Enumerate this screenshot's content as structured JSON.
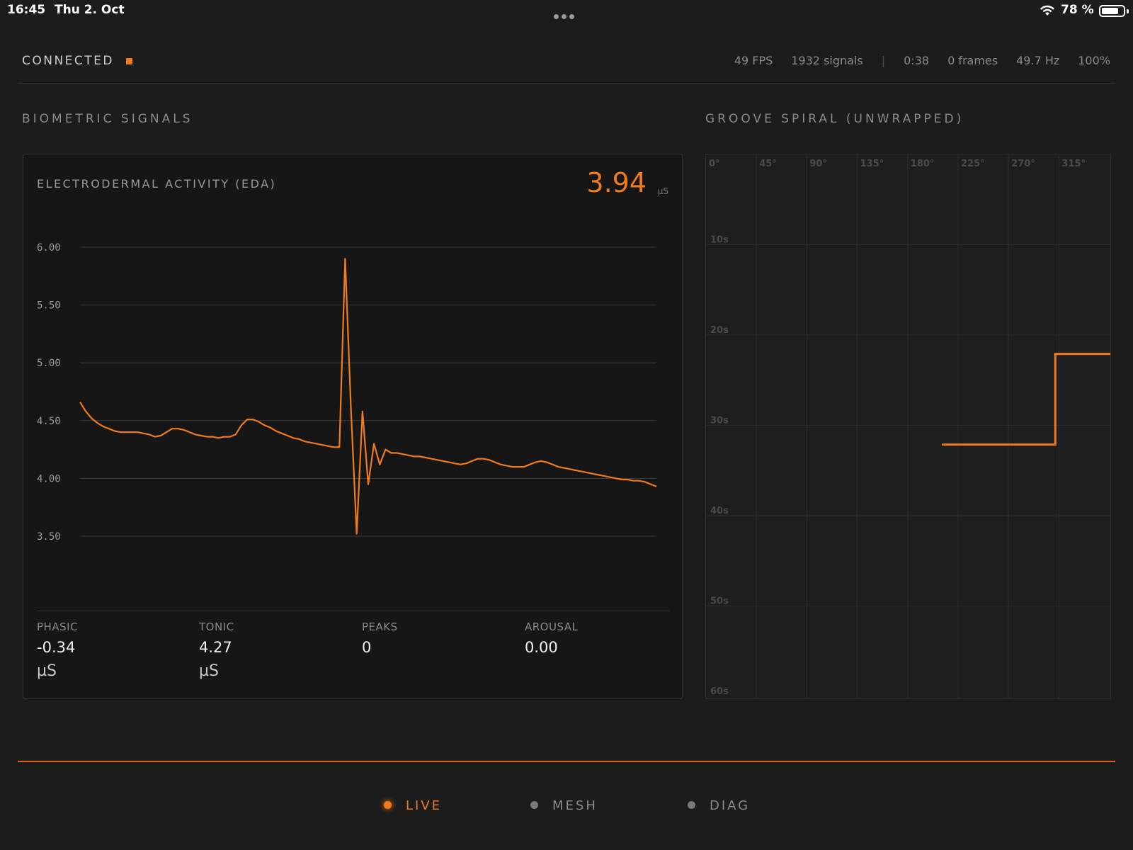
{
  "status_bar": {
    "time": "16:45",
    "date": "Thu 2. Oct",
    "battery_percent": "78 %",
    "battery_level": 0.78
  },
  "header": {
    "connection": "CONNECTED",
    "stats": {
      "fps": "49 FPS",
      "signals": "1932 signals",
      "separator": "|",
      "elapsed": "0:38",
      "frames": "0 frames",
      "frequency": "49.7 Hz",
      "zoom": "100%"
    }
  },
  "sections": {
    "biometric": "BIOMETRIC SIGNALS",
    "groove": "GROOVE SPIRAL (UNWRAPPED)"
  },
  "eda": {
    "title": "ELECTRODERMAL ACTIVITY (EDA)",
    "value": "3.94",
    "unit": "µS",
    "metrics": [
      {
        "label": "PHASIC",
        "value": "-0.34",
        "unit": "µS"
      },
      {
        "label": "TONIC",
        "value": "4.27",
        "unit": "µS"
      },
      {
        "label": "PEAKS",
        "value": "0",
        "unit": ""
      },
      {
        "label": "AROUSAL",
        "value": "0.00",
        "unit": ""
      }
    ]
  },
  "chart_data": [
    {
      "type": "line",
      "title": "ELECTRODERMAL ACTIVITY (EDA)",
      "ylim": [
        3.5,
        6.0
      ],
      "yticks": [
        "6.00",
        "5.50",
        "5.00",
        "4.50",
        "4.00",
        "3.50"
      ],
      "grid": true,
      "series": [
        {
          "color": "#f07a1c",
          "x": [
            0,
            1,
            2,
            3,
            4,
            5,
            6,
            7,
            8,
            9,
            10,
            11,
            12,
            13,
            14,
            15,
            16,
            17,
            18,
            19,
            20,
            21,
            22,
            23,
            24,
            25,
            26,
            27,
            28,
            29,
            30,
            31,
            32,
            33,
            34,
            35,
            36,
            37,
            38,
            39,
            40,
            41,
            42,
            43,
            44,
            45,
            46,
            47,
            48,
            49,
            50,
            51,
            52,
            53,
            54,
            55,
            56,
            57,
            58,
            59,
            60,
            61,
            62,
            63,
            64,
            65,
            66,
            67,
            68,
            69,
            70,
            71,
            72,
            73,
            74,
            75,
            76,
            77,
            78,
            79,
            80,
            81,
            82,
            83,
            84,
            85,
            86,
            87,
            88,
            89,
            90,
            91,
            92,
            93,
            94,
            95,
            96,
            97,
            98,
            99,
            100
          ],
          "y": [
            4.66,
            4.58,
            4.52,
            4.48,
            4.45,
            4.43,
            4.41,
            4.4,
            4.4,
            4.4,
            4.4,
            4.39,
            4.38,
            4.36,
            4.37,
            4.4,
            4.43,
            4.43,
            4.42,
            4.4,
            4.38,
            4.37,
            4.36,
            4.36,
            4.35,
            4.36,
            4.36,
            4.38,
            4.46,
            4.51,
            4.51,
            4.49,
            4.46,
            4.44,
            4.41,
            4.39,
            4.37,
            4.35,
            4.34,
            4.32,
            4.31,
            4.3,
            4.29,
            4.28,
            4.27,
            4.27,
            5.9,
            4.6,
            3.52,
            4.58,
            3.95,
            4.3,
            4.12,
            4.25,
            4.22,
            4.22,
            4.21,
            4.2,
            4.19,
            4.19,
            4.18,
            4.17,
            4.16,
            4.15,
            4.14,
            4.13,
            4.12,
            4.13,
            4.15,
            4.17,
            4.17,
            4.16,
            4.14,
            4.12,
            4.11,
            4.1,
            4.1,
            4.1,
            4.12,
            4.14,
            4.15,
            4.14,
            4.12,
            4.1,
            4.09,
            4.08,
            4.07,
            4.06,
            4.05,
            4.04,
            4.03,
            4.02,
            4.01,
            4.0,
            3.99,
            3.99,
            3.98,
            3.98,
            3.97,
            3.95,
            3.93
          ]
        }
      ]
    },
    {
      "type": "line",
      "title": "GROOVE SPIRAL (UNWRAPPED)",
      "x_ticks": [
        "0°",
        "45°",
        "90°",
        "135°",
        "180°",
        "225°",
        "270°",
        "315°"
      ],
      "y_ticks": [
        "10s",
        "20s",
        "30s",
        "40s",
        "50s",
        "60s"
      ],
      "xlim": [
        0,
        360
      ],
      "ylim": [
        0,
        60
      ],
      "grid": true,
      "series": [
        {
          "color": "#f07a1c",
          "x": [
            210,
            311,
            311,
            360
          ],
          "y": [
            32,
            32,
            22,
            22
          ]
        }
      ]
    }
  ],
  "nav": [
    {
      "label": "LIVE",
      "active": true
    },
    {
      "label": "MESH",
      "active": false
    },
    {
      "label": "DIAG",
      "active": false
    }
  ]
}
